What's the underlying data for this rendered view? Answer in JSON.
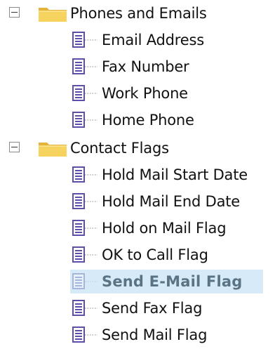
{
  "tree": {
    "groups": [
      {
        "label": "Phones and Emails",
        "expanded": true,
        "icon": "folder-icon",
        "items": [
          {
            "label": "Email Address",
            "icon": "field-icon"
          },
          {
            "label": "Fax Number",
            "icon": "field-icon"
          },
          {
            "label": "Work Phone",
            "icon": "field-icon"
          },
          {
            "label": "Home Phone",
            "icon": "field-icon"
          }
        ]
      },
      {
        "label": "Contact Flags",
        "expanded": true,
        "icon": "folder-icon",
        "items": [
          {
            "label": "Hold Mail Start Date",
            "icon": "field-icon"
          },
          {
            "label": "Hold Mail End Date",
            "icon": "field-icon"
          },
          {
            "label": "Hold on Mail Flag",
            "icon": "field-icon"
          },
          {
            "label": "OK to Call Flag",
            "icon": "field-icon"
          },
          {
            "label": "Send E-Mail Flag",
            "icon": "field-icon",
            "selected": true
          },
          {
            "label": "Send Fax Flag",
            "icon": "field-icon"
          },
          {
            "label": "Send Mail Flag",
            "icon": "field-icon"
          }
        ]
      }
    ],
    "colors": {
      "selection": "#d6ebf7",
      "folder": "#f2c94c",
      "field_icon": "#5b4fa8"
    }
  }
}
